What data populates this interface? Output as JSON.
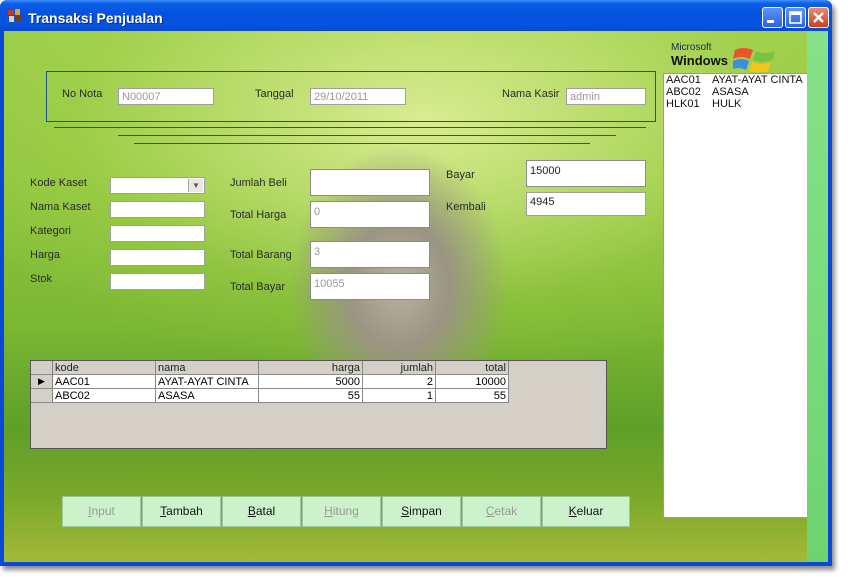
{
  "window": {
    "title": "Transaksi Penjualan"
  },
  "logo": {
    "microsoft": "Microsoft",
    "windows": "Windows"
  },
  "header": {
    "no_nota_label": "No Nota",
    "no_nota_value": "N00007",
    "tanggal_label": "Tanggal",
    "tanggal_value": "29/10/2011",
    "kasir_label": "Nama Kasir",
    "kasir_value": "admin"
  },
  "form": {
    "kode_kaset_label": "Kode Kaset",
    "nama_kaset_label": "Nama Kaset",
    "kategori_label": "Kategori",
    "harga_label": "Harga",
    "stok_label": "Stok",
    "jumlah_beli_label": "Jumlah Beli",
    "total_harga_label": "Total Harga",
    "total_harga_value": "0",
    "total_barang_label": "Total Barang",
    "total_barang_value": "3",
    "total_bayar_label": "Total Bayar",
    "total_bayar_value": "10055",
    "bayar_label": "Bayar",
    "bayar_value": "15000",
    "kembali_label": "Kembali",
    "kembali_value": "4945"
  },
  "grid": {
    "columns": [
      "kode",
      "nama",
      "harga",
      "jumlah",
      "total"
    ],
    "rows": [
      {
        "kode": "AAC01",
        "nama": "AYAT-AYAT CINTA",
        "harga": "5000",
        "jumlah": "2",
        "total": "10000",
        "current": true
      },
      {
        "kode": "ABC02",
        "nama": "ASASA",
        "harga": "55",
        "jumlah": "1",
        "total": "55",
        "current": false
      }
    ]
  },
  "list": [
    {
      "code": "AAC01",
      "title": "AYAT-AYAT CINTA"
    },
    {
      "code": "ABC02",
      "title": "ASASA"
    },
    {
      "code": "HLK01",
      "title": "HULK"
    }
  ],
  "buttons": {
    "input": {
      "label": "Input",
      "accel": "I",
      "rest": "nput"
    },
    "tambah": {
      "label": "Tambah",
      "accel": "T",
      "rest": "ambah"
    },
    "batal": {
      "label": "Batal",
      "accel": "B",
      "rest": "atal"
    },
    "hitung": {
      "label": "Hitung",
      "accel": "H",
      "rest": "itung"
    },
    "simpan": {
      "label": "Simpan",
      "accel": "S",
      "rest": "impan"
    },
    "cetak": {
      "label": "Cetak",
      "accel": "C",
      "rest": "etak"
    },
    "keluar": {
      "label": "Keluar",
      "accel": "K",
      "rest": "eluar"
    }
  },
  "colors": {
    "titlebar": "#0552dd",
    "button_bg": "#ccf2cc",
    "disabled_text": "#9a9a9a",
    "frame": "#1f4d90"
  }
}
